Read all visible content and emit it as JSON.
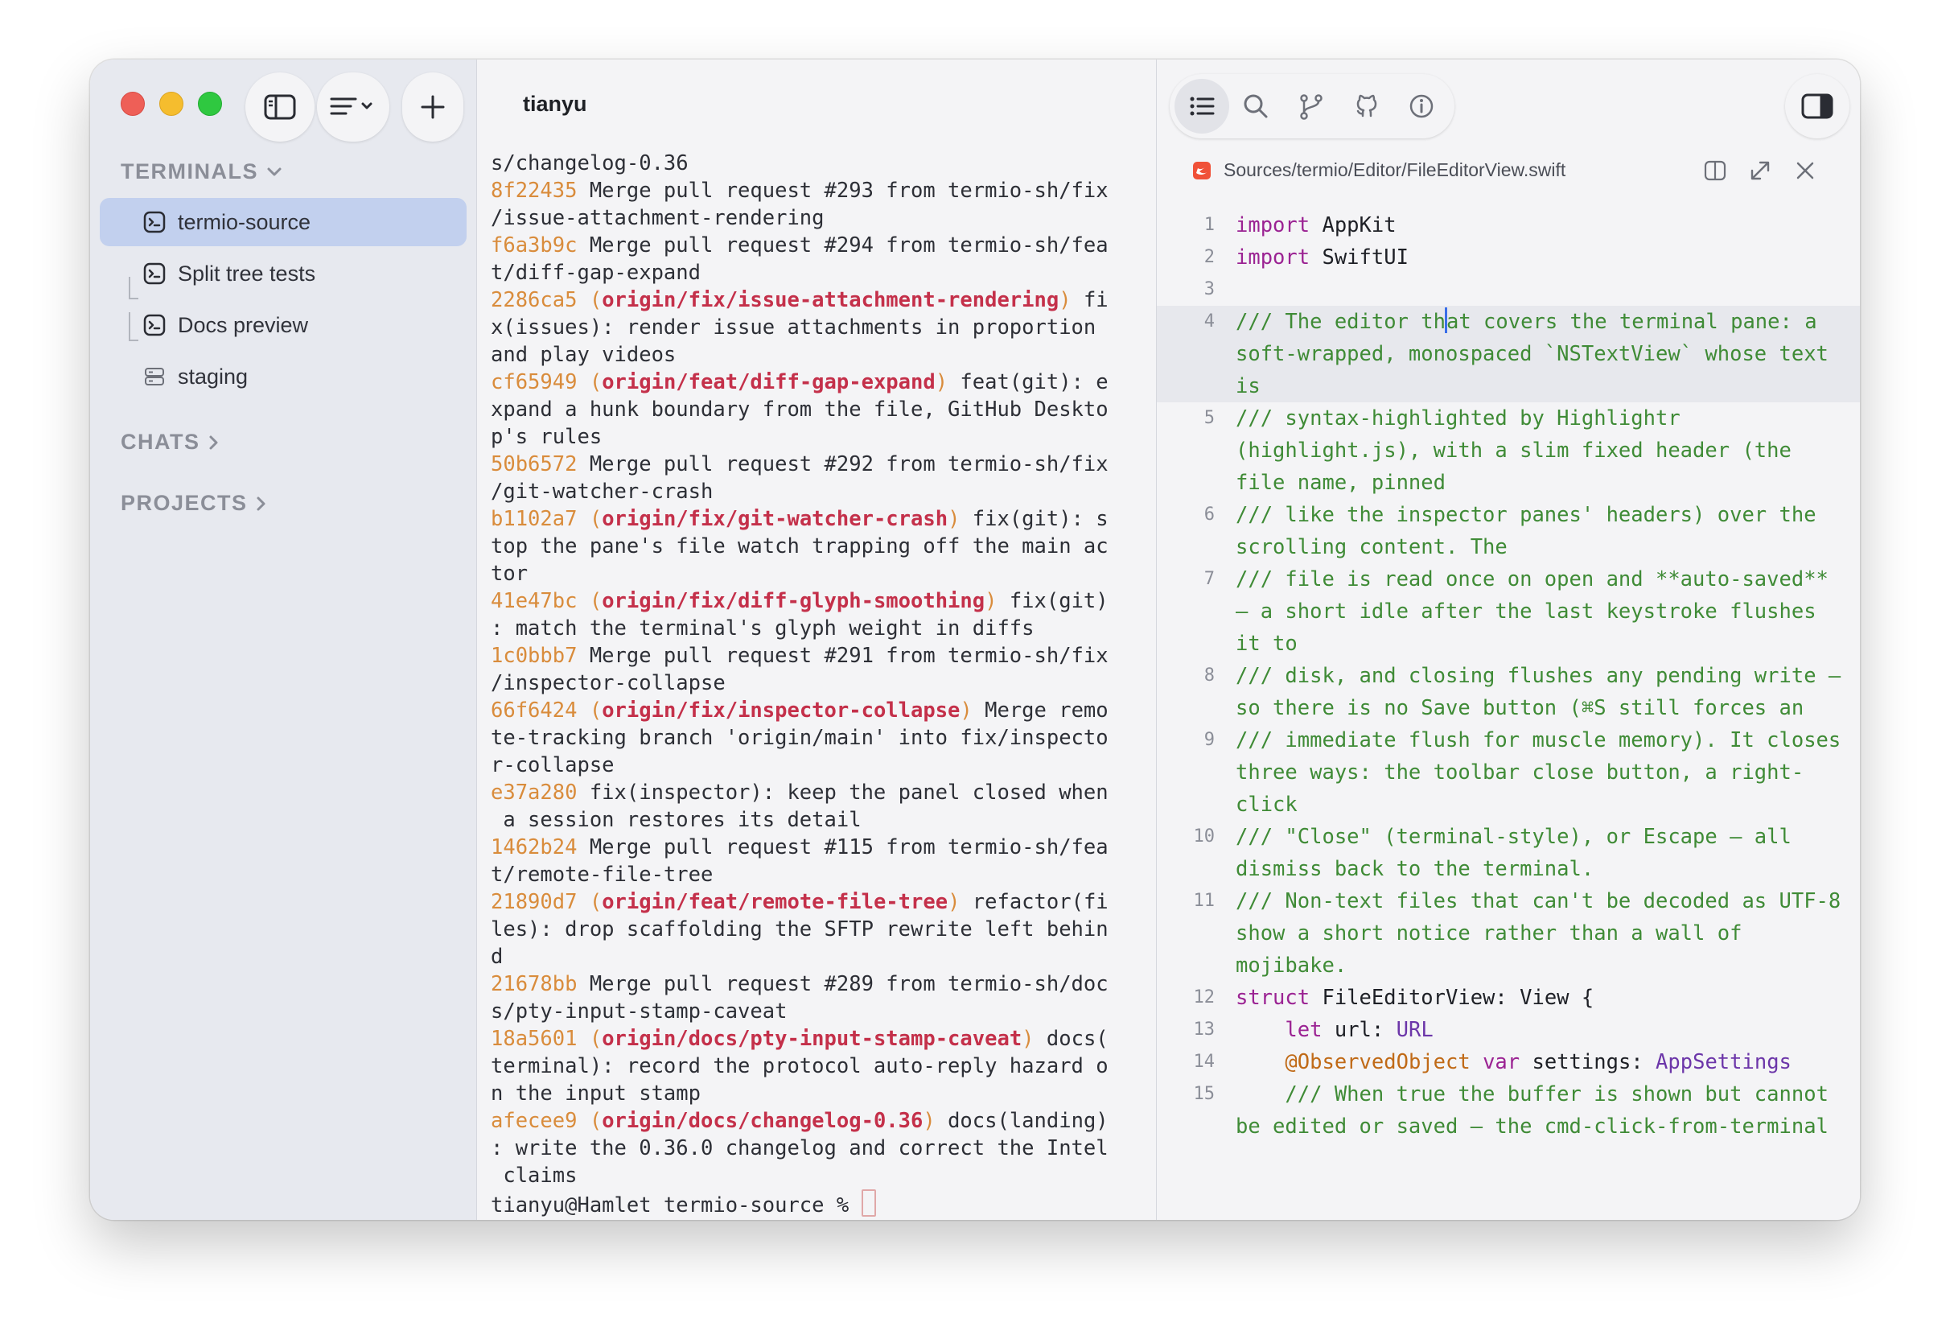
{
  "sidebar": {
    "terminals_header": "TERMINALS",
    "chats_header": "CHATS",
    "projects_header": "PROJECTS",
    "items": [
      {
        "label": "termio-source",
        "icon": "terminal-icon",
        "selected": true
      },
      {
        "label": "Split tree tests",
        "icon": "terminal-icon"
      },
      {
        "label": "Docs preview",
        "icon": "terminal-icon"
      },
      {
        "label": "staging",
        "icon": "server-icon"
      }
    ]
  },
  "terminal": {
    "title": "tianyu",
    "lines": [
      {
        "parts": [
          {
            "t": "s/changelog-0.36",
            "c": ""
          }
        ]
      },
      {
        "parts": [
          {
            "t": "8f22435",
            "c": "hash"
          },
          {
            "t": " Merge pull request #293 from termio-sh/fix",
            "c": ""
          }
        ]
      },
      {
        "parts": [
          {
            "t": "/issue-attachment-rendering",
            "c": ""
          }
        ]
      },
      {
        "parts": [
          {
            "t": "f6a3b9c",
            "c": "hash"
          },
          {
            "t": " Merge pull request #294 from termio-sh/fea",
            "c": ""
          }
        ]
      },
      {
        "parts": [
          {
            "t": "t/diff-gap-expand",
            "c": ""
          }
        ]
      },
      {
        "parts": [
          {
            "t": "2286ca5",
            "c": "hash"
          },
          {
            "t": " (",
            "c": "hash"
          },
          {
            "t": "origin/fix/issue-attachment-rendering",
            "c": "ref"
          },
          {
            "t": ")",
            "c": "hash"
          },
          {
            "t": " fi",
            "c": ""
          }
        ]
      },
      {
        "parts": [
          {
            "t": "x(issues): render issue attachments in proportion",
            "c": ""
          }
        ]
      },
      {
        "parts": [
          {
            "t": "and play videos",
            "c": ""
          }
        ]
      },
      {
        "parts": [
          {
            "t": "cf65949",
            "c": "hash"
          },
          {
            "t": " (",
            "c": "hash"
          },
          {
            "t": "origin/feat/diff-gap-expand",
            "c": "ref"
          },
          {
            "t": ")",
            "c": "hash"
          },
          {
            "t": " feat(git): e",
            "c": ""
          }
        ]
      },
      {
        "parts": [
          {
            "t": "xpand a hunk boundary from the file, GitHub Deskto",
            "c": ""
          }
        ]
      },
      {
        "parts": [
          {
            "t": "p's rules",
            "c": ""
          }
        ]
      },
      {
        "parts": [
          {
            "t": "50b6572",
            "c": "hash"
          },
          {
            "t": " Merge pull request #292 from termio-sh/fix",
            "c": ""
          }
        ]
      },
      {
        "parts": [
          {
            "t": "/git-watcher-crash",
            "c": ""
          }
        ]
      },
      {
        "parts": [
          {
            "t": "b1102a7",
            "c": "hash"
          },
          {
            "t": " (",
            "c": "hash"
          },
          {
            "t": "origin/fix/git-watcher-crash",
            "c": "ref"
          },
          {
            "t": ")",
            "c": "hash"
          },
          {
            "t": " fix(git): s",
            "c": ""
          }
        ]
      },
      {
        "parts": [
          {
            "t": "top the pane's file watch trapping off the main ac",
            "c": ""
          }
        ]
      },
      {
        "parts": [
          {
            "t": "tor",
            "c": ""
          }
        ]
      },
      {
        "parts": [
          {
            "t": "41e47bc",
            "c": "hash"
          },
          {
            "t": " (",
            "c": "hash"
          },
          {
            "t": "origin/fix/diff-glyph-smoothing",
            "c": "ref"
          },
          {
            "t": ")",
            "c": "hash"
          },
          {
            "t": " fix(git)",
            "c": ""
          }
        ]
      },
      {
        "parts": [
          {
            "t": ": match the terminal's glyph weight in diffs",
            "c": ""
          }
        ]
      },
      {
        "parts": [
          {
            "t": "1c0bbb7",
            "c": "hash"
          },
          {
            "t": " Merge pull request #291 from termio-sh/fix",
            "c": ""
          }
        ]
      },
      {
        "parts": [
          {
            "t": "/inspector-collapse",
            "c": ""
          }
        ]
      },
      {
        "parts": [
          {
            "t": "66f6424",
            "c": "hash"
          },
          {
            "t": " (",
            "c": "hash"
          },
          {
            "t": "origin/fix/inspector-collapse",
            "c": "ref"
          },
          {
            "t": ")",
            "c": "hash"
          },
          {
            "t": " Merge remo",
            "c": ""
          }
        ]
      },
      {
        "parts": [
          {
            "t": "te-tracking branch 'origin/main' into fix/inspecto",
            "c": ""
          }
        ]
      },
      {
        "parts": [
          {
            "t": "r-collapse",
            "c": ""
          }
        ]
      },
      {
        "parts": [
          {
            "t": "e37a280",
            "c": "hash"
          },
          {
            "t": " fix(inspector): keep the panel closed when",
            "c": ""
          }
        ]
      },
      {
        "parts": [
          {
            "t": " a session restores its detail",
            "c": ""
          }
        ]
      },
      {
        "parts": [
          {
            "t": "1462b24",
            "c": "hash"
          },
          {
            "t": " Merge pull request #115 from termio-sh/fea",
            "c": ""
          }
        ]
      },
      {
        "parts": [
          {
            "t": "t/remote-file-tree",
            "c": ""
          }
        ]
      },
      {
        "parts": [
          {
            "t": "21890d7",
            "c": "hash"
          },
          {
            "t": " (",
            "c": "hash"
          },
          {
            "t": "origin/feat/remote-file-tree",
            "c": "ref"
          },
          {
            "t": ")",
            "c": "hash"
          },
          {
            "t": " refactor(fi",
            "c": ""
          }
        ]
      },
      {
        "parts": [
          {
            "t": "les): drop scaffolding the SFTP rewrite left behin",
            "c": ""
          }
        ]
      },
      {
        "parts": [
          {
            "t": "d",
            "c": ""
          }
        ]
      },
      {
        "parts": [
          {
            "t": "21678bb",
            "c": "hash"
          },
          {
            "t": " Merge pull request #289 from termio-sh/doc",
            "c": ""
          }
        ]
      },
      {
        "parts": [
          {
            "t": "s/pty-input-stamp-caveat",
            "c": ""
          }
        ]
      },
      {
        "parts": [
          {
            "t": "18a5601",
            "c": "hash"
          },
          {
            "t": " (",
            "c": "hash"
          },
          {
            "t": "origin/docs/pty-input-stamp-caveat",
            "c": "ref"
          },
          {
            "t": ")",
            "c": "hash"
          },
          {
            "t": " docs(",
            "c": ""
          }
        ]
      },
      {
        "parts": [
          {
            "t": "terminal): record the protocol auto-reply hazard o",
            "c": ""
          }
        ]
      },
      {
        "parts": [
          {
            "t": "n the input stamp",
            "c": ""
          }
        ]
      },
      {
        "parts": [
          {
            "t": "afecee9",
            "c": "hash"
          },
          {
            "t": " (",
            "c": "hash"
          },
          {
            "t": "origin/docs/changelog-0.36",
            "c": "ref"
          },
          {
            "t": ")",
            "c": "hash"
          },
          {
            "t": " docs(landing)",
            "c": ""
          }
        ]
      },
      {
        "parts": [
          {
            "t": ": write the 0.36.0 changelog and correct the Intel",
            "c": ""
          }
        ]
      },
      {
        "parts": [
          {
            "t": " claims",
            "c": ""
          }
        ]
      }
    ],
    "prompt": "tianyu@Hamlet termio-source % "
  },
  "editor": {
    "toolbar_icons": [
      "list-icon",
      "search-icon",
      "git-branch-icon",
      "github-icon",
      "info-icon"
    ],
    "file_path": "Sources/termio/Editor/FileEditorView.swift",
    "code_lines": [
      {
        "n": "1",
        "parts": [
          {
            "t": "import",
            "c": "kw"
          },
          {
            "t": " AppKit",
            "c": ""
          }
        ]
      },
      {
        "n": "2",
        "parts": [
          {
            "t": "import",
            "c": "kw"
          },
          {
            "t": " SwiftUI",
            "c": ""
          }
        ]
      },
      {
        "n": "3",
        "parts": []
      },
      {
        "n": "4",
        "hl": true,
        "parts": [
          {
            "t": "/// The editor th",
            "c": "cm"
          },
          {
            "caret": true
          },
          {
            "t": "at covers the terminal pane: a soft-wrapped, monospaced `NSTextView` whose text is",
            "c": "cm"
          }
        ]
      },
      {
        "n": "5",
        "parts": [
          {
            "t": "/// syntax-highlighted by Highlightr (highlight.js), with a slim fixed header (the file name, pinned",
            "c": "cm"
          }
        ]
      },
      {
        "n": "6",
        "parts": [
          {
            "t": "/// like the inspector panes' headers) over the scrolling content. The",
            "c": "cm"
          }
        ]
      },
      {
        "n": "7",
        "parts": [
          {
            "t": "/// file is read once on open and **auto-saved** — a short idle after the last keystroke flushes it to",
            "c": "cm"
          }
        ]
      },
      {
        "n": "8",
        "parts": [
          {
            "t": "/// disk, and closing flushes any pending write — so there is no Save button (⌘S still forces an",
            "c": "cm"
          }
        ]
      },
      {
        "n": "9",
        "parts": [
          {
            "t": "/// immediate flush for muscle memory). It closes three ways: the toolbar close button, a right-click",
            "c": "cm"
          }
        ]
      },
      {
        "n": "10",
        "parts": [
          {
            "t": "/// \"Close\" (terminal-style), or Escape — all dismiss back to the terminal.",
            "c": "cm"
          }
        ]
      },
      {
        "n": "11",
        "parts": [
          {
            "t": "/// Non-text files that can't be decoded as UTF-8 show a short notice rather than a wall of mojibake.",
            "c": "cm"
          }
        ]
      },
      {
        "n": "12",
        "parts": [
          {
            "t": "struct",
            "c": "kw"
          },
          {
            "t": " FileEditorView: View {",
            "c": ""
          }
        ]
      },
      {
        "n": "13",
        "parts": [
          {
            "t": "    ",
            "c": ""
          },
          {
            "t": "let",
            "c": "kw"
          },
          {
            "t": " url: ",
            "c": ""
          },
          {
            "t": "URL",
            "c": "ty"
          }
        ]
      },
      {
        "n": "14",
        "parts": [
          {
            "t": "    ",
            "c": ""
          },
          {
            "t": "@ObservedObject",
            "c": "at"
          },
          {
            "t": " ",
            "c": ""
          },
          {
            "t": "var",
            "c": "kw"
          },
          {
            "t": " settings: ",
            "c": ""
          },
          {
            "t": "AppSettings",
            "c": "ty"
          }
        ]
      },
      {
        "n": "15",
        "parts": [
          {
            "t": "    /// When true the buffer is shown but cannot be edited or saved — the cmd-click-from-terminal",
            "c": "cm"
          }
        ]
      }
    ]
  }
}
